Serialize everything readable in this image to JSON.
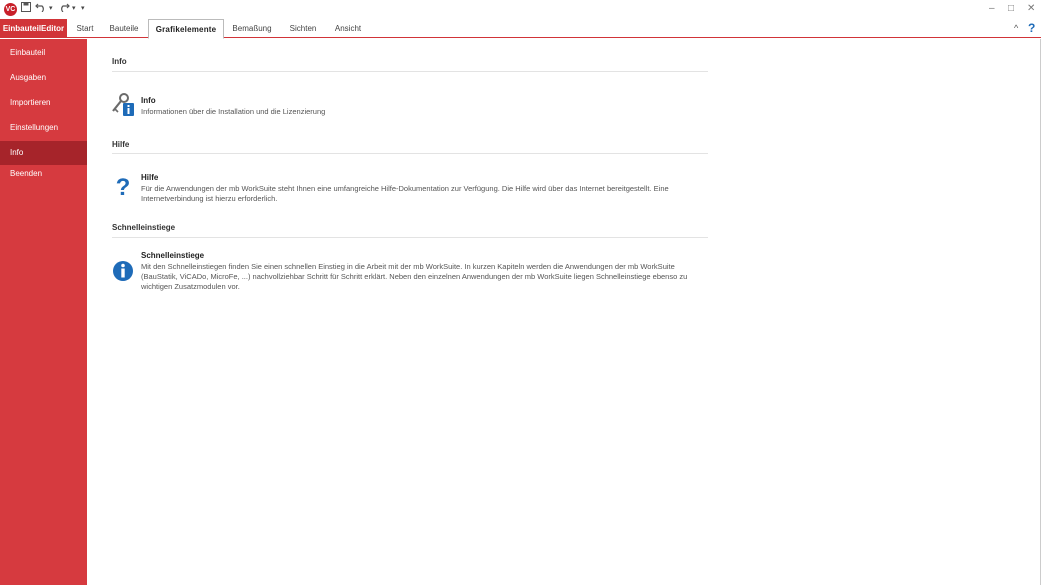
{
  "window": {
    "app_logo_text": "VC",
    "minimize": "‒",
    "maximize": "□",
    "close": "✕"
  },
  "ribbon": {
    "file_tab": "EinbauteilEditor",
    "tabs": [
      {
        "label": "Start"
      },
      {
        "label": "Bauteile"
      },
      {
        "label": "Grafikelemente"
      },
      {
        "label": "Bemaßung"
      },
      {
        "label": "Sichten"
      },
      {
        "label": "Ansicht"
      }
    ],
    "active_tab": "Grafikelemente",
    "collapse_glyph": "^",
    "help_glyph": "?"
  },
  "sidebar": {
    "items": [
      {
        "label": "Einbauteil"
      },
      {
        "label": "Ausgaben"
      },
      {
        "label": "Importieren"
      },
      {
        "label": "Einstellungen"
      },
      {
        "label": "Info"
      },
      {
        "label": "Beenden"
      }
    ],
    "active_item": "Info"
  },
  "main": {
    "sections": [
      {
        "title": "Info",
        "entry": {
          "icon": "key-info-icon",
          "title": "Info",
          "description": "Informationen über die Installation und die Lizenzierung"
        }
      },
      {
        "title": "Hilfe",
        "entry": {
          "icon": "help-question-icon",
          "title": "Hilfe",
          "description": "Für die Anwendungen der mb WorkSuite steht Ihnen eine umfangreiche Hilfe-Dokumentation zur Verfügung. Die Hilfe wird über das Internet bereitgestellt. Eine Internetverbindung ist hierzu erforderlich."
        }
      },
      {
        "title": "Schnelleinstiege",
        "entry": {
          "icon": "info-circle-icon",
          "title": "Schnelleinstiege",
          "description": "Mit den Schnelleinstiegen finden Sie einen schnellen Einstieg in die Arbeit mit der mb WorkSuite. In kurzen Kapiteln werden die Anwendungen der mb WorkSuite (BauStatik, ViCADo, MicroFe, ...) nachvollziehbar Schritt für Schritt erklärt. Neben den einzelnen Anwendungen der mb WorkSuite liegen Schnelleinstiege ebenso zu wichtigen Zusatzmodulen vor."
        }
      }
    ]
  },
  "colors": {
    "accent_red": "#d63a3f",
    "sidebar_active": "#a6242a",
    "icon_blue": "#1e6bb8"
  }
}
